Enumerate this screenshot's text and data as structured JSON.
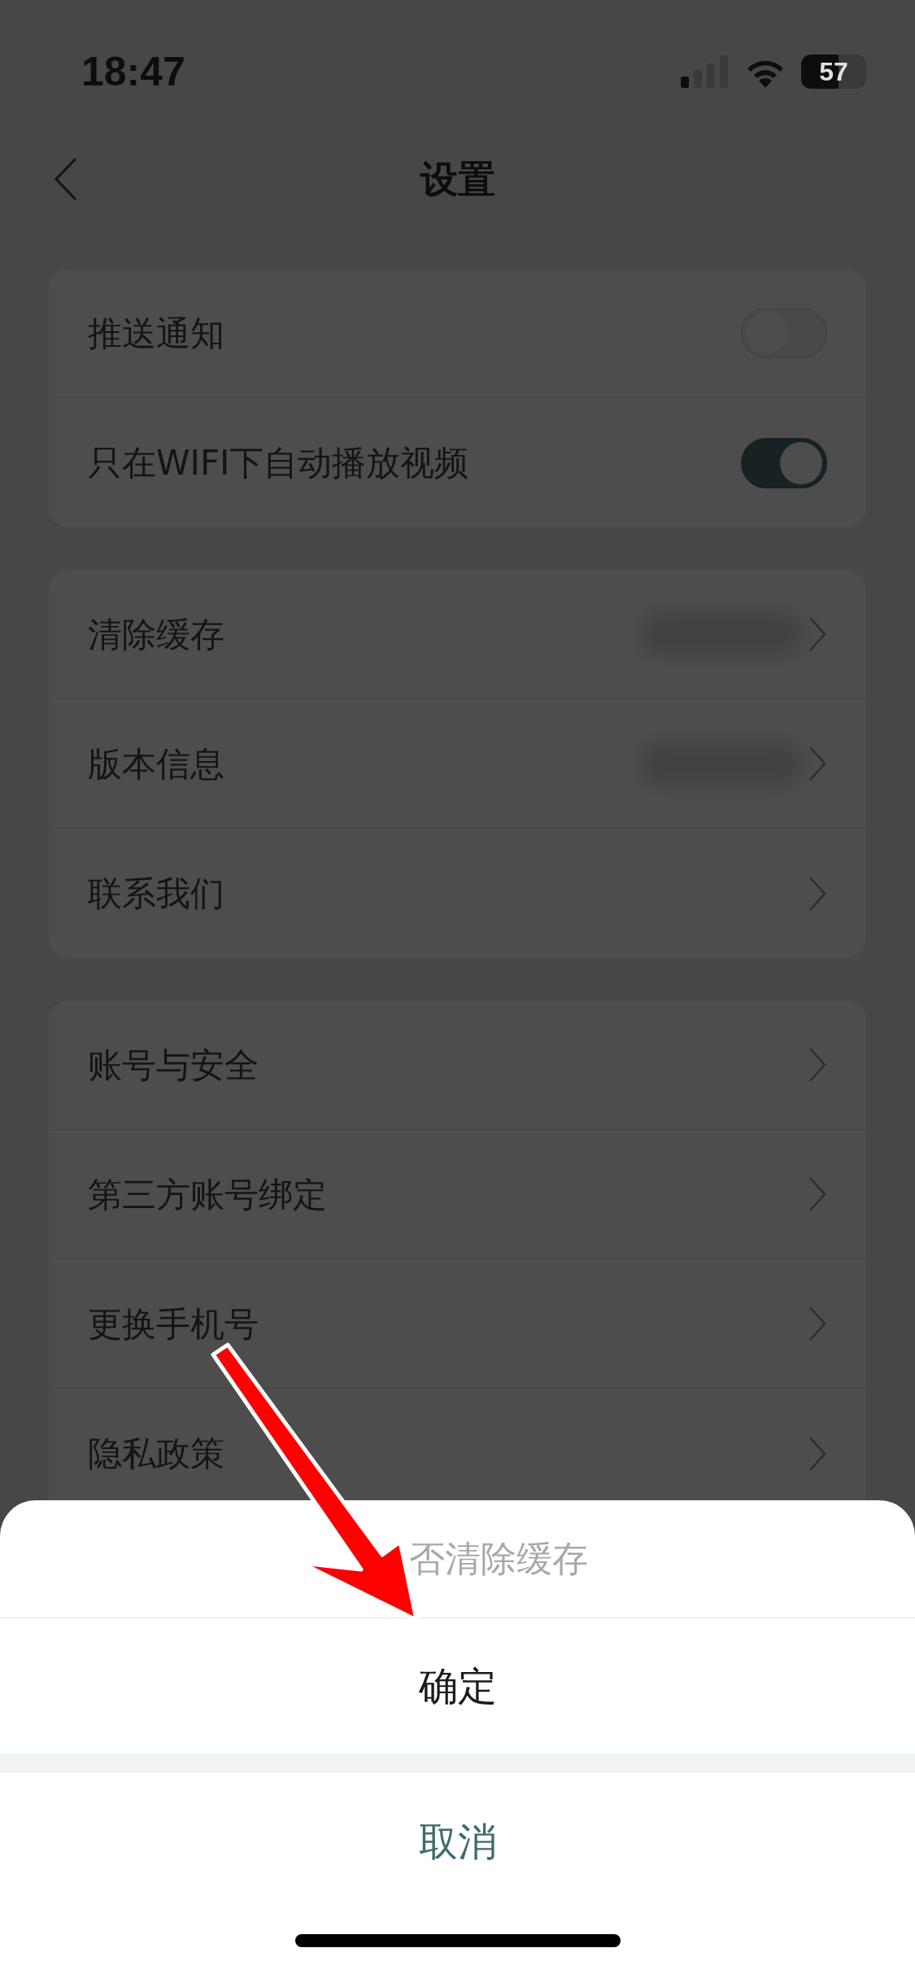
{
  "status_bar": {
    "time": "18:47",
    "battery": "57"
  },
  "nav": {
    "title": "设置"
  },
  "groups": [
    {
      "rows": [
        {
          "kind": "toggle",
          "label": "推送通知",
          "on": false
        },
        {
          "kind": "toggle",
          "label": "只在WIFI下自动播放视频",
          "on": true
        }
      ]
    },
    {
      "rows": [
        {
          "kind": "blurred",
          "label": "清除缓存"
        },
        {
          "kind": "blurred",
          "label": "版本信息"
        },
        {
          "kind": "link",
          "label": "联系我们"
        }
      ]
    },
    {
      "rows": [
        {
          "kind": "link",
          "label": "账号与安全"
        },
        {
          "kind": "link",
          "label": "第三方账号绑定"
        },
        {
          "kind": "link",
          "label": "更换手机号"
        },
        {
          "kind": "link",
          "label": "隐私政策"
        }
      ]
    }
  ],
  "action_sheet": {
    "title": "否清除缓存",
    "confirm": "确定",
    "cancel": "取消"
  }
}
